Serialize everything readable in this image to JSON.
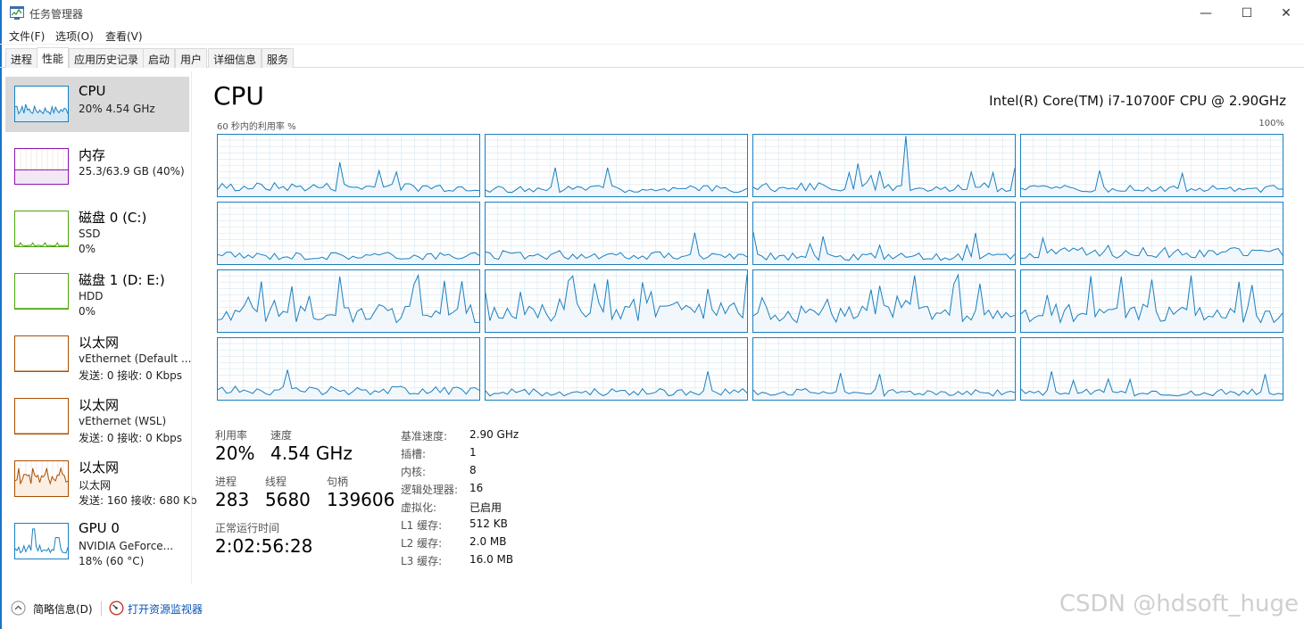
{
  "window": {
    "title": "任务管理器",
    "minimize": "—",
    "maximize": "☐",
    "close": "✕"
  },
  "menu": [
    "文件(F)",
    "选项(O)",
    "查看(V)"
  ],
  "tabs": [
    "进程",
    "性能",
    "应用历史记录",
    "启动",
    "用户",
    "详细信息",
    "服务"
  ],
  "active_tab": "性能",
  "sidebar": {
    "items": [
      {
        "title": "CPU",
        "line1": "20% 4.54 GHz",
        "line2": "",
        "color": "#1a7fc0",
        "fill": "#d7e9f5",
        "selected": true
      },
      {
        "title": "内存",
        "line1": "25.3/63.9 GB (40%)",
        "line2": "",
        "color": "#8b12ae",
        "fill": "#f1e8f4",
        "selected": false
      },
      {
        "title": "磁盘 0 (C:)",
        "line1": "SSD",
        "line2": "0%",
        "color": "#4da60c",
        "fill": "#ffffff",
        "selected": false
      },
      {
        "title": "磁盘 1 (D: E:)",
        "line1": "HDD",
        "line2": "0%",
        "color": "#4da60c",
        "fill": "#ffffff",
        "selected": false
      },
      {
        "title": "以太网",
        "line1": "vEthernet (Default ...",
        "line2": "发送: 0 接收: 0 Kbps",
        "color": "#a74f01",
        "fill": "#ffffff",
        "selected": false
      },
      {
        "title": "以太网",
        "line1": "vEthernet (WSL)",
        "line2": "发送: 0 接收: 0 Kbps",
        "color": "#a74f01",
        "fill": "#ffffff",
        "selected": false
      },
      {
        "title": "以太网",
        "line1": "以太网",
        "line2": "发送: 160 接收: 680 Kb",
        "color": "#a74f01",
        "fill": "#fbeee2",
        "selected": false
      },
      {
        "title": "GPU 0",
        "line1": "NVIDIA GeForce...",
        "line2": "18% (60 °C)",
        "color": "#1a7fc0",
        "fill": "#ffffff",
        "selected": false
      }
    ]
  },
  "main": {
    "title": "CPU",
    "model": "Intel(R) Core(TM) i7-10700F CPU @ 2.90GHz",
    "graph_caption": "60 秒内的利用率 %",
    "graph_max": "100%",
    "graph_color": "#1a7fc0",
    "graph_fill": "#f1f6fb",
    "grid_color": "#d6e7f2"
  },
  "stats": {
    "utilization_label": "利用率",
    "utilization": "20%",
    "speed_label": "速度",
    "speed": "4.54 GHz",
    "processes_label": "进程",
    "processes": "283",
    "threads_label": "线程",
    "threads": "5680",
    "handles_label": "句柄",
    "handles": "139606",
    "uptime_label": "正常运行时间",
    "uptime": "2:02:56:28"
  },
  "details": [
    {
      "label": "基准速度:",
      "value": "2.90 GHz"
    },
    {
      "label": "插槽:",
      "value": "1"
    },
    {
      "label": "内核:",
      "value": "8"
    },
    {
      "label": "逻辑处理器:",
      "value": "16"
    },
    {
      "label": "虚拟化:",
      "value": "已启用"
    },
    {
      "label": "L1 缓存:",
      "value": "512 KB"
    },
    {
      "label": "L2 缓存:",
      "value": "2.0 MB"
    },
    {
      "label": "L3 缓存:",
      "value": "16.0 MB"
    }
  ],
  "footer": {
    "brief": "简略信息(D)",
    "resource_monitor": "打开资源监视器"
  },
  "watermark": "CSDN @hdsoft_huge"
}
